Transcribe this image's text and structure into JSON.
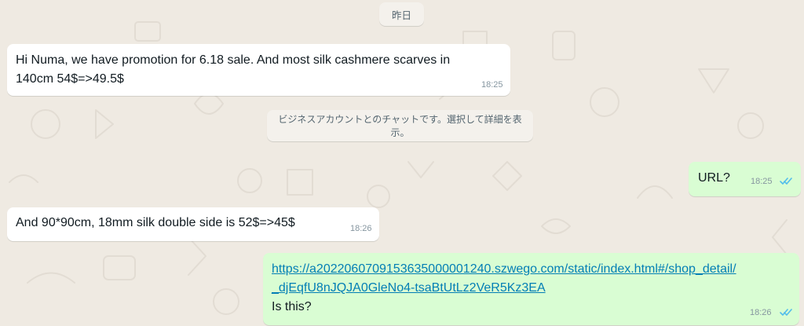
{
  "date_divider": "昨日",
  "system_notice": "ビジネスアカウントとのチャットです。選択して詳細を表示。",
  "messages": [
    {
      "direction": "incoming",
      "lines": [
        "Hi Numa, we have promotion for 6.18 sale. And most silk cashmere scarves in",
        "140cm  54$=>49.5$"
      ],
      "time": "18:25"
    },
    {
      "direction": "outgoing",
      "text": "URL?",
      "time": "18:25",
      "status": "read"
    },
    {
      "direction": "incoming",
      "text": "And 90*90cm, 18mm silk double side is 52$=>45$",
      "time": "18:26"
    },
    {
      "direction": "outgoing",
      "link_lines": [
        "https://a2022060709153635000001240.szwego.com/static/index.html#/shop_detail/",
        "_djEqfU8nJQJA0GleNo4-tsaBtUtLz2VeR5Kz3EA"
      ],
      "text": "Is this?",
      "time": "18:26",
      "status": "read"
    }
  ],
  "colors": {
    "background": "#efeae2",
    "incoming_bubble": "#ffffff",
    "outgoing_bubble": "#d9fdd3",
    "link": "#027eb5",
    "read_ticks": "#53bdeb",
    "timestamp": "#8696a0"
  },
  "icons": {
    "read_receipt": "double-check-icon"
  }
}
